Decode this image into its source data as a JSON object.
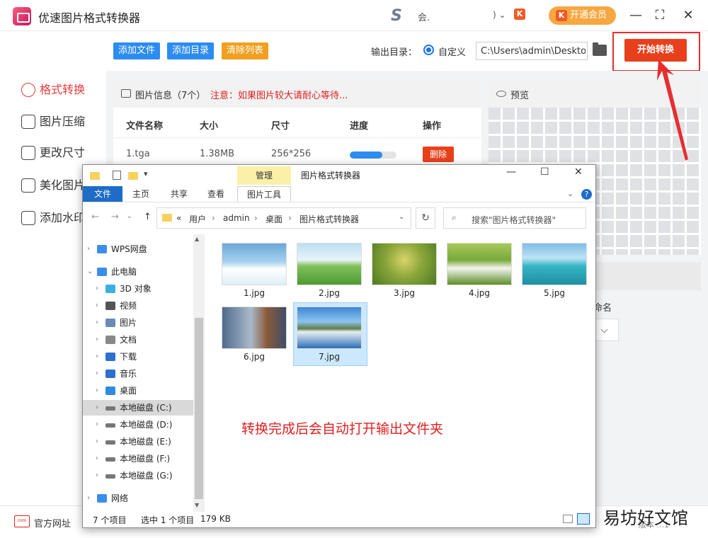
{
  "app": {
    "title": "优速图片格式转换器",
    "user_name": "会.",
    "user_suffix": ")",
    "vip_button": "开通会员",
    "vip_badge": "K"
  },
  "nav": {
    "items": [
      {
        "label": "格式转换",
        "active": true
      },
      {
        "label": "图片压缩",
        "active": false
      },
      {
        "label": "更改尺寸",
        "active": false
      },
      {
        "label": "美化图片",
        "active": false
      },
      {
        "label": "添加水印",
        "active": false
      }
    ]
  },
  "toolbar": {
    "add_file": "添加文件",
    "add_dir": "添加目录",
    "clear_list": "清除列表",
    "output_label": "输出目录：",
    "custom_option": "自定义",
    "output_path": "C:\\Users\\admin\\Desktop",
    "start_button": "开始转换"
  },
  "file_panel": {
    "title": "图片信息（7个）",
    "warning": "注意：如果图片较大请耐心等待...",
    "columns": [
      "文件名称",
      "大小",
      "尺寸",
      "进度",
      "操作"
    ],
    "rows": [
      {
        "name": "1.tga",
        "size": "1.38MB",
        "dimensions": "256*256",
        "progress": 0.7,
        "action": "删除"
      }
    ]
  },
  "preview": {
    "title": "预览",
    "rename_label": "命名"
  },
  "bottombar": {
    "site_link": "官方网址",
    "site_icon_text": "com",
    "watermark": "易坊好文馆",
    "version_fragment": "版本 ...1"
  },
  "explorer": {
    "title": "图片格式转换器",
    "context_tab": "管理",
    "ribbon_tabs": [
      "文件",
      "主页",
      "共享",
      "查看",
      "图片工具"
    ],
    "breadcrumb": [
      "«",
      "用户",
      "admin",
      "桌面",
      "图片格式转换器"
    ],
    "search_placeholder": "搜索\"图片格式转换器\"",
    "tree": [
      {
        "label": "WPS网盘",
        "icon": "cloud-icon",
        "indent": 0
      },
      {
        "label": "此电脑",
        "icon": "computer-icon",
        "indent": 0,
        "expanded": true
      },
      {
        "label": "3D 对象",
        "icon": "cube-icon",
        "indent": 1
      },
      {
        "label": "视频",
        "icon": "video-icon",
        "indent": 1
      },
      {
        "label": "图片",
        "icon": "picture-icon",
        "indent": 1
      },
      {
        "label": "文档",
        "icon": "document-icon",
        "indent": 1
      },
      {
        "label": "下载",
        "icon": "download-icon",
        "indent": 1
      },
      {
        "label": "音乐",
        "icon": "music-icon",
        "indent": 1
      },
      {
        "label": "桌面",
        "icon": "desktop-icon",
        "indent": 1
      },
      {
        "label": "本地磁盘 (C:)",
        "icon": "drive-icon",
        "indent": 1,
        "selected": true
      },
      {
        "label": "本地磁盘 (D:)",
        "icon": "drive-icon",
        "indent": 1
      },
      {
        "label": "本地磁盘 (E:)",
        "icon": "drive-icon",
        "indent": 1
      },
      {
        "label": "本地磁盘 (F:)",
        "icon": "drive-icon",
        "indent": 1
      },
      {
        "label": "本地磁盘 (G:)",
        "icon": "drive-icon",
        "indent": 1
      },
      {
        "label": "网络",
        "icon": "network-icon",
        "indent": 0
      }
    ],
    "files": [
      {
        "name": "1.jpg",
        "scene": "sky-clouds"
      },
      {
        "name": "2.jpg",
        "scene": "green-meadow"
      },
      {
        "name": "3.jpg",
        "scene": "yellow-flowers"
      },
      {
        "name": "4.jpg",
        "scene": "daisies"
      },
      {
        "name": "5.jpg",
        "scene": "sea-pier"
      },
      {
        "name": "6.jpg",
        "scene": "foggy-lake"
      },
      {
        "name": "7.jpg",
        "scene": "harbor",
        "selected": true
      }
    ],
    "annotation": "转换完成后会自动打开输出文件夹",
    "status": {
      "count": "7 个项目",
      "selection": "选中 1 个项目",
      "size": "179 KB"
    }
  },
  "colors": {
    "accent_red": "#e8401c",
    "nav_active": "#e83a3a",
    "btn_blue": "#2d8cf0",
    "btn_orange": "#f0a020",
    "vip_orange": "#f7a742"
  }
}
